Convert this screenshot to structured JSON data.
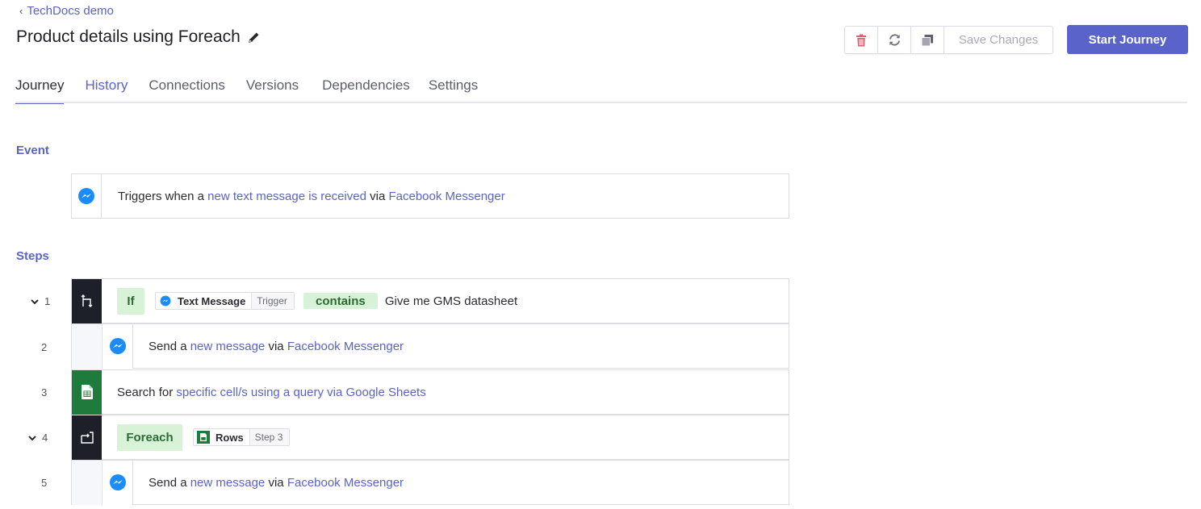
{
  "header": {
    "back_label": "TechDocs demo",
    "title": "Product details using Foreach",
    "save_label": "Save Changes",
    "start_label": "Start Journey",
    "icons": [
      "trash-icon",
      "refresh-icon",
      "duplicate-icon",
      "pencil-icon"
    ]
  },
  "tabs": [
    "Journey",
    "History",
    "Connections",
    "Versions",
    "Dependencies",
    "Settings"
  ],
  "event": {
    "section_label": "Event",
    "text_prefix": "Triggers when a",
    "trigger_link": "new text message is received",
    "via": "via",
    "app": "Facebook Messenger"
  },
  "steps": {
    "section_label": "Steps",
    "items": [
      {
        "num": "1",
        "keyword": "If",
        "chip_label": "Text Message",
        "chip_tag": "Trigger",
        "operator": "contains",
        "value": "Give me GMS datasheet"
      },
      {
        "num": "2",
        "prefix": "Send a",
        "link": "new message",
        "via": "via",
        "app": "Facebook Messenger"
      },
      {
        "num": "3",
        "prefix": "Search for",
        "link": "specific cell/s using a query via Google Sheets"
      },
      {
        "num": "4",
        "keyword": "Foreach",
        "chip_label": "Rows",
        "chip_tag": "Step 3"
      },
      {
        "num": "5",
        "prefix": "Send a",
        "link": "new message",
        "via": "via",
        "app": "Facebook Messenger"
      }
    ]
  },
  "colors": {
    "accent": "#5a63c9",
    "messenger": "#1a8cff",
    "sheets": "#1e7b3c",
    "dark_step": "#1d1f29",
    "pill_bg": "#d8f2d8",
    "trash": "#e06073"
  }
}
